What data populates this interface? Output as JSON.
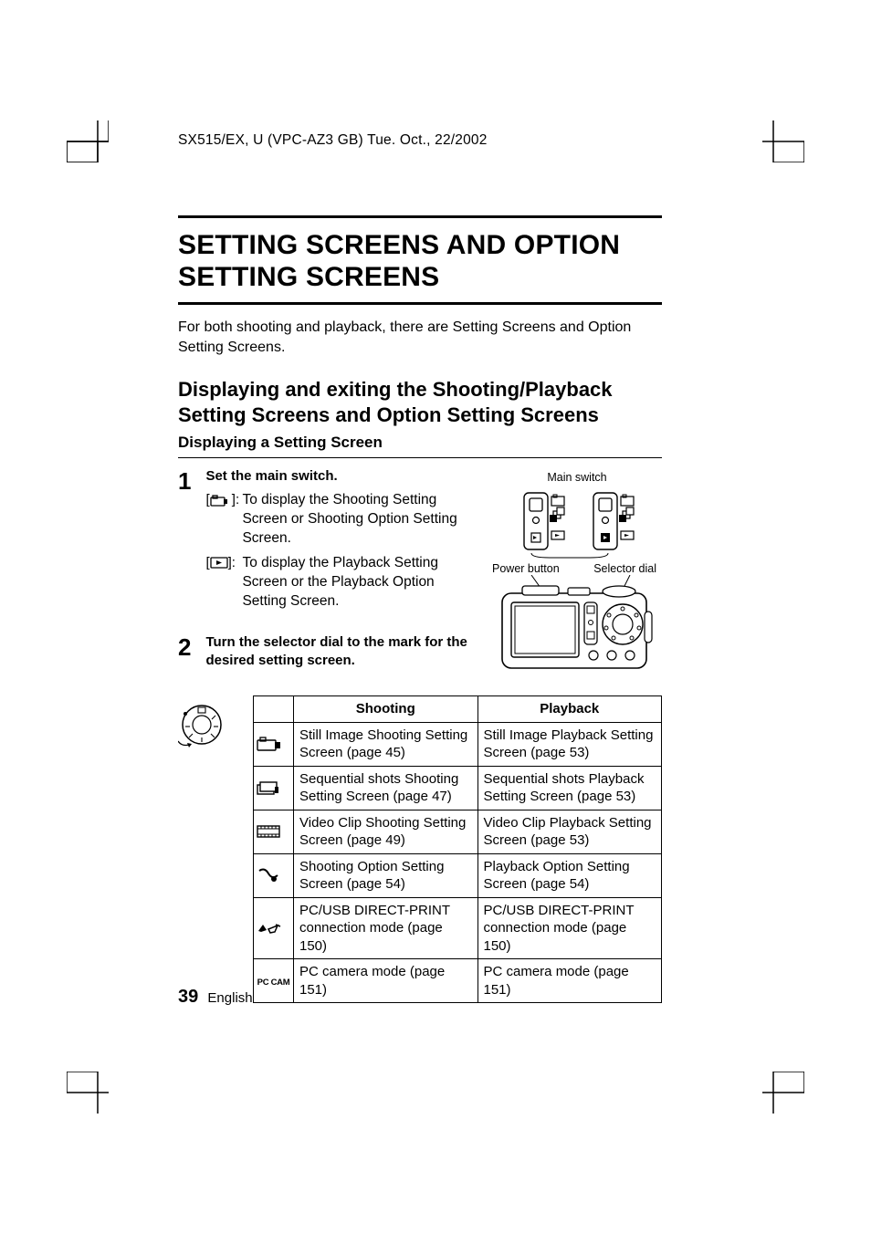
{
  "header": "SX515/EX, U (VPC-AZ3 GB)    Tue. Oct., 22/2002",
  "title": "SETTING SCREENS AND OPTION SETTING SCREENS",
  "intro": "For both shooting and playback, there are Setting Screens and Option Setting Screens.",
  "section_h2": "Displaying and exiting the Shooting/Playback Setting Screens and Option Setting Screens",
  "section_h3": "Displaying a Setting Screen",
  "step1": {
    "num": "1",
    "title": "Set the main switch.",
    "bullet1": "To display the Shooting Setting Screen or Shooting Option Setting Screen.",
    "bullet2": "To display the Playback Setting Screen or the Playback Option Setting Screen."
  },
  "step2": {
    "num": "2",
    "title": "Turn the selector dial to the mark for the desired setting screen."
  },
  "labels": {
    "main_switch": "Main switch",
    "power_button": "Power button",
    "selector_dial": "Selector dial"
  },
  "table": {
    "headers": {
      "col1": "",
      "col2": "Shooting",
      "col3": "Playback"
    },
    "rows": [
      {
        "shooting": "Still Image Shooting Setting Screen (page 45)",
        "playback": "Still Image Playback Setting Screen (page 53)"
      },
      {
        "shooting": "Sequential shots Shooting Setting Screen (page 47)",
        "playback": "Sequential shots Playback Setting Screen (page 53)"
      },
      {
        "shooting": "Video Clip Shooting Setting Screen (page 49)",
        "playback": "Video Clip Playback Setting Screen (page 53)"
      },
      {
        "shooting": "Shooting Option Setting Screen (page 54)",
        "playback": "Playback Option Setting Screen (page 54)"
      },
      {
        "shooting": "PC/USB DIRECT-PRINT connection mode (page 150)",
        "playback": "PC/USB DIRECT-PRINT connection mode (page 150)"
      },
      {
        "icon_text": "PC CAM",
        "shooting": "PC camera mode (page 151)",
        "playback": "PC camera mode (page 151)"
      }
    ]
  },
  "footer": {
    "page": "39",
    "lang": "English"
  }
}
